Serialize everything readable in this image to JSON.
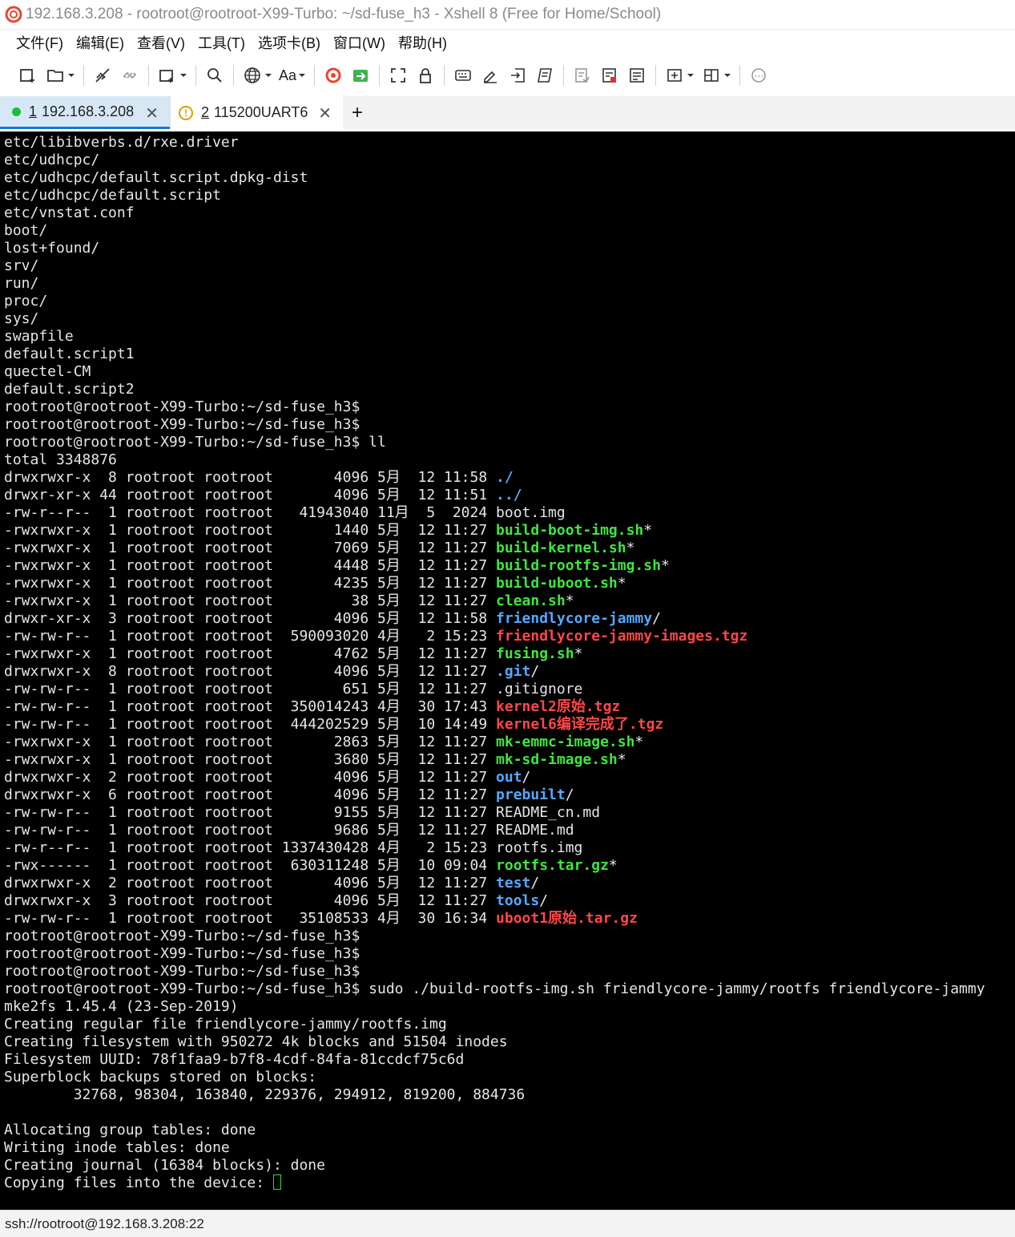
{
  "window": {
    "title": "192.168.3.208 - rootroot@rootroot-X99-Turbo: ~/sd-fuse_h3 - Xshell 8 (Free for Home/School)"
  },
  "menu": [
    "文件(F)",
    "编辑(E)",
    "查看(V)",
    "工具(T)",
    "选项卡(B)",
    "窗口(W)",
    "帮助(H)"
  ],
  "toolbar": {
    "font_label": "Aa",
    "icons": [
      "new-session-icon",
      "open-folder-icon",
      "disconnect-icon",
      "reconnect-icon",
      "new-window-icon",
      "search-icon",
      "globe-icon",
      "font-icon",
      "xshell-logo-icon",
      "xftp-icon",
      "fullscreen-icon",
      "lock-icon",
      "keyboard-icon",
      "highlight-icon",
      "send-icon",
      "script-icon",
      "log-icon",
      "compose-icon",
      "notes-icon",
      "add-pane-icon",
      "layout-icon",
      "chat-icon"
    ]
  },
  "tabs": [
    {
      "num": "1",
      "label": "192.168.3.208",
      "status": "connected"
    },
    {
      "num": "2",
      "label": "115200UART6",
      "status": "warning"
    }
  ],
  "tab_add_label": "+",
  "colors": {
    "terminal_bg": "#000000",
    "terminal_fg": "#e6e6e6",
    "exec": "#3ee63e",
    "dir": "#55a8ff",
    "archive": "#ff4747",
    "active_tab": "#d7e7f6"
  },
  "terminal": {
    "lines": [
      [
        {
          "t": "etc/libibverbs.d/rxe.driver"
        }
      ],
      [
        {
          "t": "etc/udhcpc/"
        }
      ],
      [
        {
          "t": "etc/udhcpc/default.script.dpkg-dist"
        }
      ],
      [
        {
          "t": "etc/udhcpc/default.script"
        }
      ],
      [
        {
          "t": "etc/vnstat.conf"
        }
      ],
      [
        {
          "t": "boot/"
        }
      ],
      [
        {
          "t": "lost+found/"
        }
      ],
      [
        {
          "t": "srv/"
        }
      ],
      [
        {
          "t": "run/"
        }
      ],
      [
        {
          "t": "proc/"
        }
      ],
      [
        {
          "t": "sys/"
        }
      ],
      [
        {
          "t": "swapfile"
        }
      ],
      [
        {
          "t": "default.script1"
        }
      ],
      [
        {
          "t": "quectel-CM"
        }
      ],
      [
        {
          "t": "default.script2"
        }
      ],
      [
        {
          "t": "rootroot@rootroot-X99-Turbo:~/sd-fuse_h3$"
        }
      ],
      [
        {
          "t": "rootroot@rootroot-X99-Turbo:~/sd-fuse_h3$"
        }
      ],
      [
        {
          "t": "rootroot@rootroot-X99-Turbo:~/sd-fuse_h3$ ll"
        }
      ],
      [
        {
          "t": "total 3348876"
        }
      ],
      [
        {
          "t": "drwxrwxr-x  8 rootroot rootroot       4096 5月  12 11:58 "
        },
        {
          "t": "./",
          "c": "dir"
        }
      ],
      [
        {
          "t": "drwxr-xr-x 44 rootroot rootroot       4096 5月  12 11:51 "
        },
        {
          "t": "../",
          "c": "dir"
        }
      ],
      [
        {
          "t": "-rw-r--r--  1 rootroot rootroot   41943040 11月  5  2024 boot.img"
        }
      ],
      [
        {
          "t": "-rwxrwxr-x  1 rootroot rootroot       1440 5月  12 11:27 "
        },
        {
          "t": "build-boot-img.sh",
          "c": "exec"
        },
        {
          "t": "*"
        }
      ],
      [
        {
          "t": "-rwxrwxr-x  1 rootroot rootroot       7069 5月  12 11:27 "
        },
        {
          "t": "build-kernel.sh",
          "c": "exec"
        },
        {
          "t": "*"
        }
      ],
      [
        {
          "t": "-rwxrwxr-x  1 rootroot rootroot       4448 5月  12 11:27 "
        },
        {
          "t": "build-rootfs-img.sh",
          "c": "exec"
        },
        {
          "t": "*"
        }
      ],
      [
        {
          "t": "-rwxrwxr-x  1 rootroot rootroot       4235 5月  12 11:27 "
        },
        {
          "t": "build-uboot.sh",
          "c": "exec"
        },
        {
          "t": "*"
        }
      ],
      [
        {
          "t": "-rwxrwxr-x  1 rootroot rootroot         38 5月  12 11:27 "
        },
        {
          "t": "clean.sh",
          "c": "exec"
        },
        {
          "t": "*"
        }
      ],
      [
        {
          "t": "drwxr-xr-x  3 rootroot rootroot       4096 5月  12 11:58 "
        },
        {
          "t": "friendlycore-jammy",
          "c": "dir"
        },
        {
          "t": "/"
        }
      ],
      [
        {
          "t": "-rw-rw-r--  1 rootroot rootroot  590093020 4月   2 15:23 "
        },
        {
          "t": "friendlycore-jammy-images.tgz",
          "c": "archive"
        }
      ],
      [
        {
          "t": "-rwxrwxr-x  1 rootroot rootroot       4762 5月  12 11:27 "
        },
        {
          "t": "fusing.sh",
          "c": "exec"
        },
        {
          "t": "*"
        }
      ],
      [
        {
          "t": "drwxrwxr-x  8 rootroot rootroot       4096 5月  12 11:27 "
        },
        {
          "t": ".git",
          "c": "dir"
        },
        {
          "t": "/"
        }
      ],
      [
        {
          "t": "-rw-rw-r--  1 rootroot rootroot        651 5月  12 11:27 .gitignore"
        }
      ],
      [
        {
          "t": "-rw-rw-r--  1 rootroot rootroot  350014243 4月  30 17:43 "
        },
        {
          "t": "kernel2原始.tgz",
          "c": "archive"
        }
      ],
      [
        {
          "t": "-rw-rw-r--  1 rootroot rootroot  444202529 5月  10 14:49 "
        },
        {
          "t": "kernel6编译完成了.tgz",
          "c": "archive"
        }
      ],
      [
        {
          "t": "-rwxrwxr-x  1 rootroot rootroot       2863 5月  12 11:27 "
        },
        {
          "t": "mk-emmc-image.sh",
          "c": "exec"
        },
        {
          "t": "*"
        }
      ],
      [
        {
          "t": "-rwxrwxr-x  1 rootroot rootroot       3680 5月  12 11:27 "
        },
        {
          "t": "mk-sd-image.sh",
          "c": "exec"
        },
        {
          "t": "*"
        }
      ],
      [
        {
          "t": "drwxrwxr-x  2 rootroot rootroot       4096 5月  12 11:27 "
        },
        {
          "t": "out",
          "c": "dir"
        },
        {
          "t": "/"
        }
      ],
      [
        {
          "t": "drwxrwxr-x  6 rootroot rootroot       4096 5月  12 11:27 "
        },
        {
          "t": "prebuilt",
          "c": "dir"
        },
        {
          "t": "/"
        }
      ],
      [
        {
          "t": "-rw-rw-r--  1 rootroot rootroot       9155 5月  12 11:27 README_cn.md"
        }
      ],
      [
        {
          "t": "-rw-rw-r--  1 rootroot rootroot       9686 5月  12 11:27 README.md"
        }
      ],
      [
        {
          "t": "-rw-r--r--  1 rootroot rootroot 1337430428 4月   2 15:23 rootfs.img"
        }
      ],
      [
        {
          "t": "-rwx------  1 rootroot rootroot  630311248 5月  10 09:04 "
        },
        {
          "t": "rootfs.tar.gz",
          "c": "exec"
        },
        {
          "t": "*"
        }
      ],
      [
        {
          "t": "drwxrwxr-x  2 rootroot rootroot       4096 5月  12 11:27 "
        },
        {
          "t": "test",
          "c": "dir"
        },
        {
          "t": "/"
        }
      ],
      [
        {
          "t": "drwxrwxr-x  3 rootroot rootroot       4096 5月  12 11:27 "
        },
        {
          "t": "tools",
          "c": "dir"
        },
        {
          "t": "/"
        }
      ],
      [
        {
          "t": "-rw-rw-r--  1 rootroot rootroot   35108533 4月  30 16:34 "
        },
        {
          "t": "uboot1原始.tar.gz",
          "c": "archive"
        }
      ],
      [
        {
          "t": "rootroot@rootroot-X99-Turbo:~/sd-fuse_h3$"
        }
      ],
      [
        {
          "t": "rootroot@rootroot-X99-Turbo:~/sd-fuse_h3$"
        }
      ],
      [
        {
          "t": "rootroot@rootroot-X99-Turbo:~/sd-fuse_h3$"
        }
      ],
      [
        {
          "t": "rootroot@rootroot-X99-Turbo:~/sd-fuse_h3$ sudo ./build-rootfs-img.sh friendlycore-jammy/rootfs friendlycore-jammy"
        }
      ],
      [
        {
          "t": "mke2fs 1.45.4 (23-Sep-2019)"
        }
      ],
      [
        {
          "t": "Creating regular file friendlycore-jammy/rootfs.img"
        }
      ],
      [
        {
          "t": "Creating filesystem with 950272 4k blocks and 51504 inodes"
        }
      ],
      [
        {
          "t": "Filesystem UUID: 78f1faa9-b7f8-4cdf-84fa-81ccdcf75c6d"
        }
      ],
      [
        {
          "t": "Superblock backups stored on blocks:"
        }
      ],
      [
        {
          "t": "        32768, 98304, 163840, 229376, 294912, 819200, 884736"
        }
      ],
      [
        {
          "t": ""
        }
      ],
      [
        {
          "t": "Allocating group tables: done"
        }
      ],
      [
        {
          "t": "Writing inode tables: done"
        }
      ],
      [
        {
          "t": "Creating journal (16384 blocks): done"
        }
      ],
      [
        {
          "t": "Copying files into the device: "
        },
        {
          "t": "",
          "c": "cursor"
        }
      ]
    ]
  },
  "status": {
    "connection": "ssh://rootroot@192.168.3.208:22"
  }
}
